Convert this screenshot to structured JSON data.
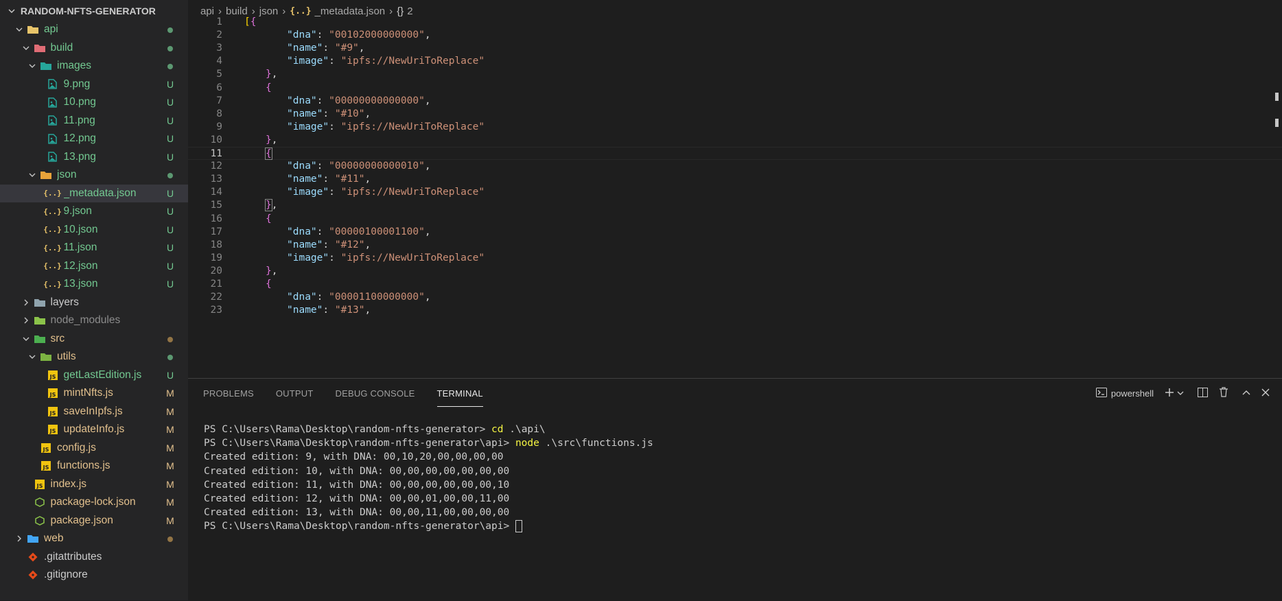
{
  "explorer": {
    "title": "RANDOM-NFTS-GENERATOR",
    "items": [
      {
        "label": "api",
        "depth": 0,
        "type": "folder-open",
        "icon": "folder-open-icon",
        "iconColor": "#e8c46a",
        "labelColor": "#73c991",
        "status": "dot",
        "statusColor": "#73c991",
        "chevron": "down"
      },
      {
        "label": "build",
        "depth": 1,
        "type": "folder-open",
        "icon": "folder-red-icon",
        "iconColor": "#e06c75",
        "labelColor": "#73c991",
        "status": "dot",
        "statusColor": "#73c991",
        "chevron": "down"
      },
      {
        "label": "images",
        "depth": 2,
        "type": "folder-open",
        "icon": "folder-images-icon",
        "iconColor": "#26a69a",
        "labelColor": "#73c991",
        "status": "dot",
        "statusColor": "#73c991",
        "chevron": "down"
      },
      {
        "label": "9.png",
        "depth": 3,
        "type": "file",
        "icon": "image-file-icon",
        "iconColor": "#26a69a",
        "labelColor": "#73c991",
        "status": "U",
        "statusColor": "#73c991"
      },
      {
        "label": "10.png",
        "depth": 3,
        "type": "file",
        "icon": "image-file-icon",
        "iconColor": "#26a69a",
        "labelColor": "#73c991",
        "status": "U",
        "statusColor": "#73c991"
      },
      {
        "label": "11.png",
        "depth": 3,
        "type": "file",
        "icon": "image-file-icon",
        "iconColor": "#26a69a",
        "labelColor": "#73c991",
        "status": "U",
        "statusColor": "#73c991"
      },
      {
        "label": "12.png",
        "depth": 3,
        "type": "file",
        "icon": "image-file-icon",
        "iconColor": "#26a69a",
        "labelColor": "#73c991",
        "status": "U",
        "statusColor": "#73c991"
      },
      {
        "label": "13.png",
        "depth": 3,
        "type": "file",
        "icon": "image-file-icon",
        "iconColor": "#26a69a",
        "labelColor": "#73c991",
        "status": "U",
        "statusColor": "#73c991"
      },
      {
        "label": "json",
        "depth": 2,
        "type": "folder-open",
        "icon": "folder-json-icon",
        "iconColor": "#e8a33a",
        "labelColor": "#73c991",
        "status": "dot",
        "statusColor": "#73c991",
        "chevron": "down"
      },
      {
        "label": "_metadata.json",
        "depth": 3,
        "type": "file",
        "icon": "json-file-icon",
        "iconColor": "#e9c46a",
        "labelColor": "#73c991",
        "status": "U",
        "statusColor": "#73c991",
        "selected": true
      },
      {
        "label": "9.json",
        "depth": 3,
        "type": "file",
        "icon": "json-file-icon",
        "iconColor": "#e9c46a",
        "labelColor": "#73c991",
        "status": "U",
        "statusColor": "#73c991"
      },
      {
        "label": "10.json",
        "depth": 3,
        "type": "file",
        "icon": "json-file-icon",
        "iconColor": "#e9c46a",
        "labelColor": "#73c991",
        "status": "U",
        "statusColor": "#73c991"
      },
      {
        "label": "11.json",
        "depth": 3,
        "type": "file",
        "icon": "json-file-icon",
        "iconColor": "#e9c46a",
        "labelColor": "#73c991",
        "status": "U",
        "statusColor": "#73c991"
      },
      {
        "label": "12.json",
        "depth": 3,
        "type": "file",
        "icon": "json-file-icon",
        "iconColor": "#e9c46a",
        "labelColor": "#73c991",
        "status": "U",
        "statusColor": "#73c991"
      },
      {
        "label": "13.json",
        "depth": 3,
        "type": "file",
        "icon": "json-file-icon",
        "iconColor": "#e9c46a",
        "labelColor": "#73c991",
        "status": "U",
        "statusColor": "#73c991"
      },
      {
        "label": "layers",
        "depth": 1,
        "type": "folder",
        "icon": "folder-icon",
        "iconColor": "#90a4ae",
        "labelColor": "#cccccc",
        "status": "",
        "statusColor": "",
        "chevron": "right"
      },
      {
        "label": "node_modules",
        "depth": 1,
        "type": "folder",
        "icon": "folder-node-icon",
        "iconColor": "#8bc34a",
        "labelColor": "#8c8c8c",
        "status": "",
        "statusColor": "",
        "chevron": "right"
      },
      {
        "label": "src",
        "depth": 1,
        "type": "folder-open",
        "icon": "folder-src-icon",
        "iconColor": "#4caf50",
        "labelColor": "#e2c08d",
        "status": "dot",
        "statusColor": "#c09553",
        "chevron": "down"
      },
      {
        "label": "utils",
        "depth": 2,
        "type": "folder-open",
        "icon": "folder-utils-icon",
        "iconColor": "#7cb342",
        "labelColor": "#e2c08d",
        "status": "dot",
        "statusColor": "#73c991",
        "chevron": "down"
      },
      {
        "label": "getLastEdition.js",
        "depth": 3,
        "type": "file",
        "icon": "js-file-icon",
        "iconColor": "#f1c40f",
        "labelColor": "#73c991",
        "status": "U",
        "statusColor": "#73c991"
      },
      {
        "label": "mintNfts.js",
        "depth": 3,
        "type": "file",
        "icon": "js-file-icon",
        "iconColor": "#f1c40f",
        "labelColor": "#e2c08d",
        "status": "M",
        "statusColor": "#e2c08d"
      },
      {
        "label": "saveInIpfs.js",
        "depth": 3,
        "type": "file",
        "icon": "js-file-icon",
        "iconColor": "#f1c40f",
        "labelColor": "#e2c08d",
        "status": "M",
        "statusColor": "#e2c08d"
      },
      {
        "label": "updateInfo.js",
        "depth": 3,
        "type": "file",
        "icon": "js-file-icon",
        "iconColor": "#f1c40f",
        "labelColor": "#e2c08d",
        "status": "M",
        "statusColor": "#e2c08d"
      },
      {
        "label": "config.js",
        "depth": 2,
        "type": "file",
        "icon": "js-file-icon",
        "iconColor": "#f1c40f",
        "labelColor": "#e2c08d",
        "status": "M",
        "statusColor": "#e2c08d"
      },
      {
        "label": "functions.js",
        "depth": 2,
        "type": "file",
        "icon": "js-file-icon",
        "iconColor": "#f1c40f",
        "labelColor": "#e2c08d",
        "status": "M",
        "statusColor": "#e2c08d"
      },
      {
        "label": "index.js",
        "depth": 1,
        "type": "file",
        "icon": "js-file-icon",
        "iconColor": "#f1c40f",
        "labelColor": "#e2c08d",
        "status": "M",
        "statusColor": "#e2c08d"
      },
      {
        "label": "package-lock.json",
        "depth": 1,
        "type": "file",
        "icon": "npm-file-icon",
        "iconColor": "#8bc34a",
        "labelColor": "#e2c08d",
        "status": "M",
        "statusColor": "#e2c08d"
      },
      {
        "label": "package.json",
        "depth": 1,
        "type": "file",
        "icon": "npm-file-icon",
        "iconColor": "#8bc34a",
        "labelColor": "#e2c08d",
        "status": "M",
        "statusColor": "#e2c08d"
      },
      {
        "label": "web",
        "depth": 0,
        "type": "folder",
        "icon": "folder-web-icon",
        "iconColor": "#42a5f5",
        "labelColor": "#e2c08d",
        "status": "dot",
        "statusColor": "#c09553",
        "chevron": "right"
      },
      {
        "label": ".gitattributes",
        "depth": 0,
        "type": "file",
        "icon": "git-file-icon",
        "iconColor": "#e64a19",
        "labelColor": "#cccccc",
        "status": "",
        "statusColor": ""
      },
      {
        "label": ".gitignore",
        "depth": 0,
        "type": "file",
        "icon": "git-file-icon",
        "iconColor": "#e64a19",
        "labelColor": "#cccccc",
        "status": "",
        "statusColor": ""
      }
    ]
  },
  "breadcrumb": {
    "parts": [
      "api",
      "build",
      "json"
    ],
    "file_icon": "{..}",
    "file": "_metadata.json",
    "symbol_icon": "{}",
    "symbol": "2"
  },
  "editor": {
    "current_line": 11,
    "lines": [
      {
        "n": "1",
        "indent": 0,
        "tokens": [
          {
            "t": "[",
            "c": "b1"
          },
          {
            "t": "{",
            "c": "b2"
          }
        ]
      },
      {
        "n": "2",
        "indent": 2,
        "tokens": [
          {
            "t": "\"dna\"",
            "c": "k"
          },
          {
            "t": ": ",
            "c": "p"
          },
          {
            "t": "\"00102000000000\"",
            "c": "s"
          },
          {
            "t": ",",
            "c": "p"
          }
        ]
      },
      {
        "n": "3",
        "indent": 2,
        "tokens": [
          {
            "t": "\"name\"",
            "c": "k"
          },
          {
            "t": ": ",
            "c": "p"
          },
          {
            "t": "\"#9\"",
            "c": "s"
          },
          {
            "t": ",",
            "c": "p"
          }
        ]
      },
      {
        "n": "4",
        "indent": 2,
        "tokens": [
          {
            "t": "\"image\"",
            "c": "k"
          },
          {
            "t": ": ",
            "c": "p"
          },
          {
            "t": "\"ipfs://NewUriToReplace\"",
            "c": "s"
          }
        ]
      },
      {
        "n": "5",
        "indent": 1,
        "tokens": [
          {
            "t": "}",
            "c": "b2"
          },
          {
            "t": ",",
            "c": "p"
          }
        ]
      },
      {
        "n": "6",
        "indent": 1,
        "tokens": [
          {
            "t": "{",
            "c": "b2"
          }
        ]
      },
      {
        "n": "7",
        "indent": 2,
        "tokens": [
          {
            "t": "\"dna\"",
            "c": "k"
          },
          {
            "t": ": ",
            "c": "p"
          },
          {
            "t": "\"00000000000000\"",
            "c": "s"
          },
          {
            "t": ",",
            "c": "p"
          }
        ]
      },
      {
        "n": "8",
        "indent": 2,
        "tokens": [
          {
            "t": "\"name\"",
            "c": "k"
          },
          {
            "t": ": ",
            "c": "p"
          },
          {
            "t": "\"#10\"",
            "c": "s"
          },
          {
            "t": ",",
            "c": "p"
          }
        ]
      },
      {
        "n": "9",
        "indent": 2,
        "tokens": [
          {
            "t": "\"image\"",
            "c": "k"
          },
          {
            "t": ": ",
            "c": "p"
          },
          {
            "t": "\"ipfs://NewUriToReplace\"",
            "c": "s"
          }
        ]
      },
      {
        "n": "10",
        "indent": 1,
        "tokens": [
          {
            "t": "}",
            "c": "b2"
          },
          {
            "t": ",",
            "c": "p"
          }
        ]
      },
      {
        "n": "11",
        "indent": 1,
        "tokens": [
          {
            "t": "{",
            "c": "b2 bracket-box"
          }
        ]
      },
      {
        "n": "12",
        "indent": 2,
        "tokens": [
          {
            "t": "\"dna\"",
            "c": "k"
          },
          {
            "t": ": ",
            "c": "p"
          },
          {
            "t": "\"00000000000010\"",
            "c": "s"
          },
          {
            "t": ",",
            "c": "p"
          }
        ]
      },
      {
        "n": "13",
        "indent": 2,
        "tokens": [
          {
            "t": "\"name\"",
            "c": "k"
          },
          {
            "t": ": ",
            "c": "p"
          },
          {
            "t": "\"#11\"",
            "c": "s"
          },
          {
            "t": ",",
            "c": "p"
          }
        ]
      },
      {
        "n": "14",
        "indent": 2,
        "tokens": [
          {
            "t": "\"image\"",
            "c": "k"
          },
          {
            "t": ": ",
            "c": "p"
          },
          {
            "t": "\"ipfs://NewUriToReplace\"",
            "c": "s"
          }
        ]
      },
      {
        "n": "15",
        "indent": 1,
        "tokens": [
          {
            "t": "}",
            "c": "b2 bracket-box"
          },
          {
            "t": ",",
            "c": "p"
          }
        ]
      },
      {
        "n": "16",
        "indent": 1,
        "tokens": [
          {
            "t": "{",
            "c": "b2"
          }
        ]
      },
      {
        "n": "17",
        "indent": 2,
        "tokens": [
          {
            "t": "\"dna\"",
            "c": "k"
          },
          {
            "t": ": ",
            "c": "p"
          },
          {
            "t": "\"00000100001100\"",
            "c": "s"
          },
          {
            "t": ",",
            "c": "p"
          }
        ]
      },
      {
        "n": "18",
        "indent": 2,
        "tokens": [
          {
            "t": "\"name\"",
            "c": "k"
          },
          {
            "t": ": ",
            "c": "p"
          },
          {
            "t": "\"#12\"",
            "c": "s"
          },
          {
            "t": ",",
            "c": "p"
          }
        ]
      },
      {
        "n": "19",
        "indent": 2,
        "tokens": [
          {
            "t": "\"image\"",
            "c": "k"
          },
          {
            "t": ": ",
            "c": "p"
          },
          {
            "t": "\"ipfs://NewUriToReplace\"",
            "c": "s"
          }
        ]
      },
      {
        "n": "20",
        "indent": 1,
        "tokens": [
          {
            "t": "}",
            "c": "b2"
          },
          {
            "t": ",",
            "c": "p"
          }
        ]
      },
      {
        "n": "21",
        "indent": 1,
        "tokens": [
          {
            "t": "{",
            "c": "b2"
          }
        ]
      },
      {
        "n": "22",
        "indent": 2,
        "tokens": [
          {
            "t": "\"dna\"",
            "c": "k"
          },
          {
            "t": ": ",
            "c": "p"
          },
          {
            "t": "\"00001100000000\"",
            "c": "s"
          },
          {
            "t": ",",
            "c": "p"
          }
        ]
      },
      {
        "n": "23",
        "indent": 2,
        "tokens": [
          {
            "t": "\"name\"",
            "c": "k"
          },
          {
            "t": ": ",
            "c": "p"
          },
          {
            "t": "\"#13\"",
            "c": "s"
          },
          {
            "t": ",",
            "c": "p"
          }
        ]
      }
    ]
  },
  "panel": {
    "tabs": [
      "PROBLEMS",
      "OUTPUT",
      "DEBUG CONSOLE",
      "TERMINAL"
    ],
    "active_tab": "TERMINAL",
    "shell_label": "powershell"
  },
  "terminal": {
    "lines": [
      {
        "prompt": "PS C:\\Users\\Rama\\Desktop\\random-nfts-generator> ",
        "cmd": "cd",
        "args": " .\\api\\"
      },
      {
        "prompt": "PS C:\\Users\\Rama\\Desktop\\random-nfts-generator\\api> ",
        "cmd": "node",
        "args": " .\\src\\functions.js"
      },
      {
        "prompt": "Created edition: 9, with DNA: 00,10,20,00,00,00,00",
        "cmd": "",
        "args": ""
      },
      {
        "prompt": "Created edition: 10, with DNA: 00,00,00,00,00,00,00",
        "cmd": "",
        "args": ""
      },
      {
        "prompt": "Created edition: 11, with DNA: 00,00,00,00,00,00,10",
        "cmd": "",
        "args": ""
      },
      {
        "prompt": "Created edition: 12, with DNA: 00,00,01,00,00,11,00",
        "cmd": "",
        "args": ""
      },
      {
        "prompt": "Created edition: 13, with DNA: 00,00,11,00,00,00,00",
        "cmd": "",
        "args": ""
      },
      {
        "prompt": "PS C:\\Users\\Rama\\Desktop\\random-nfts-generator\\api> ",
        "cmd": "",
        "args": "",
        "cursor": true
      }
    ]
  }
}
